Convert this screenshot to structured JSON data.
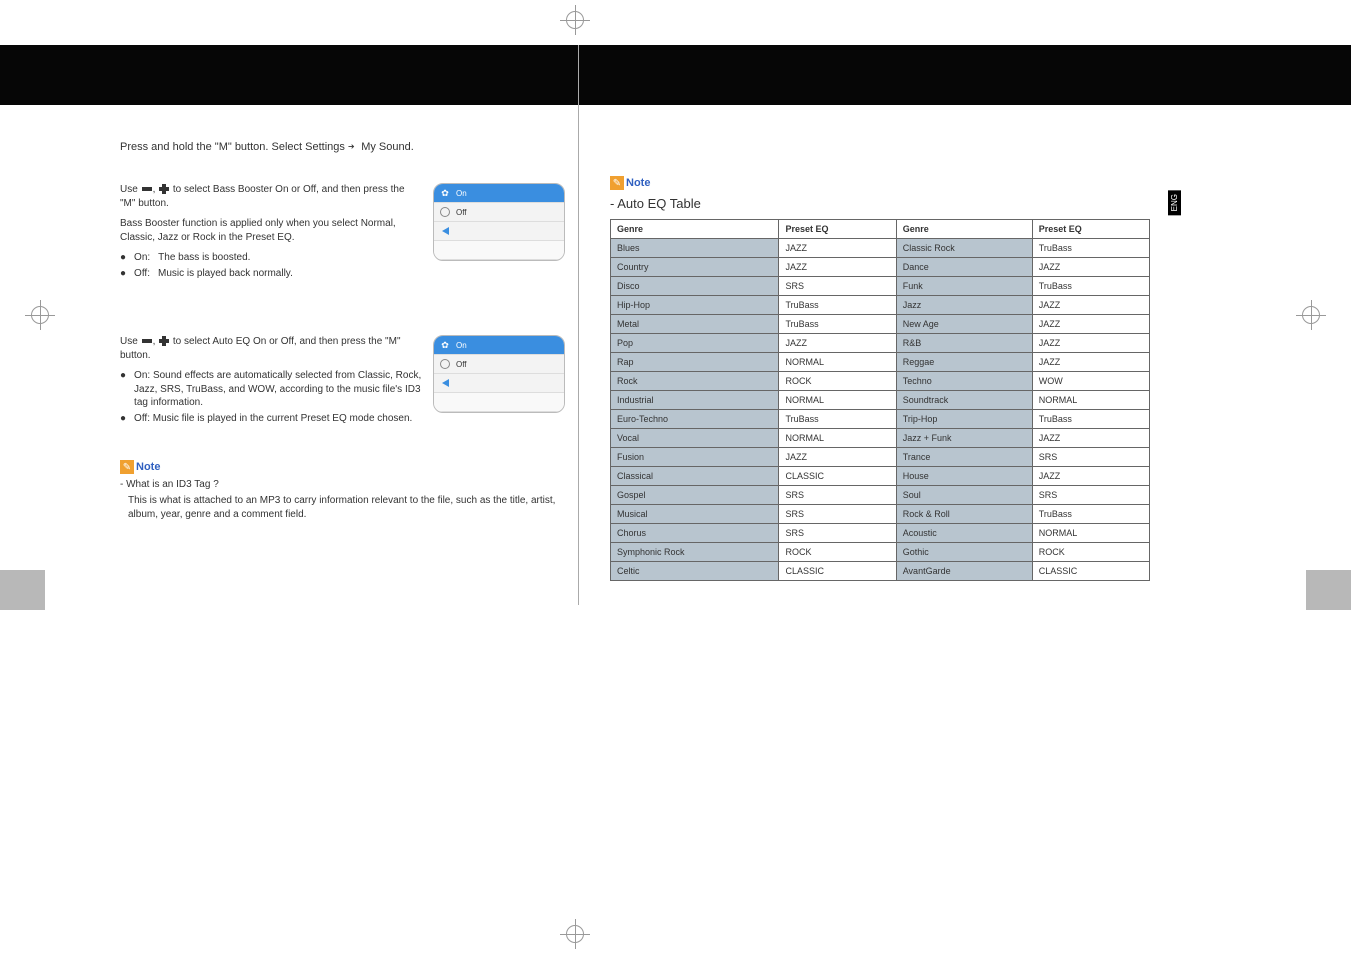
{
  "eng_label": "ENG",
  "intro_part1": "Press and hold the \"M\" button. Select Settings",
  "intro_part2": "My Sound.",
  "section1": {
    "line1_pre": "Use ",
    "line1_mid": ", ",
    "line1_post": " to select Bass Booster On or Off, and then press the \"M\" button.",
    "line2": "Bass Booster function is applied only when you select Normal, Classic, Jazz or Rock in the Preset EQ.",
    "bullet_on_label": "On:",
    "bullet_on_text": "The bass is boosted.",
    "bullet_off_label": "Off:",
    "bullet_off_text": "Music is played back normally."
  },
  "device1": {
    "row1": "On",
    "row2": "Off"
  },
  "section2": {
    "line1_pre": "Use ",
    "line1_mid": ", ",
    "line1_post": " to select Auto EQ On or Off, and then press the \"M\" button.",
    "bullet_on_label": "On:",
    "bullet_on_text": "Sound effects are automatically selected from Classic, Rock, Jazz, SRS, TruBass, and WOW, according to the music file's ID3 tag information.",
    "bullet_off_label": "Off:",
    "bullet_off_text": "Music file is played in the current Preset EQ mode chosen."
  },
  "device2": {
    "row1": "On",
    "row2": "Off"
  },
  "note_label": "Note",
  "note_left": {
    "title": "- What is an ID3 Tag ?",
    "body": "This is what is attached to an MP3 to carry information relevant to the file, such as the title, artist, album, year, genre and a comment field."
  },
  "auto_eq_title": "- Auto EQ Table",
  "table_headers": {
    "h1": "Genre",
    "h2": "Preset EQ",
    "h3": "Genre",
    "h4": "Preset EQ"
  },
  "table_rows": [
    {
      "g1": "Blues",
      "e1": "JAZZ",
      "g2": "Classic Rock",
      "e2": "TruBass"
    },
    {
      "g1": "Country",
      "e1": "JAZZ",
      "g2": "Dance",
      "e2": "JAZZ"
    },
    {
      "g1": "Disco",
      "e1": "SRS",
      "g2": "Funk",
      "e2": "TruBass"
    },
    {
      "g1": "Hip-Hop",
      "e1": "TruBass",
      "g2": "Jazz",
      "e2": "JAZZ"
    },
    {
      "g1": "Metal",
      "e1": "TruBass",
      "g2": "New Age",
      "e2": "JAZZ"
    },
    {
      "g1": "Pop",
      "e1": "JAZZ",
      "g2": "R&B",
      "e2": "JAZZ"
    },
    {
      "g1": "Rap",
      "e1": "NORMAL",
      "g2": "Reggae",
      "e2": "JAZZ"
    },
    {
      "g1": "Rock",
      "e1": "ROCK",
      "g2": "Techno",
      "e2": "WOW"
    },
    {
      "g1": "Industrial",
      "e1": "NORMAL",
      "g2": "Soundtrack",
      "e2": "NORMAL"
    },
    {
      "g1": "Euro-Techno",
      "e1": "TruBass",
      "g2": "Trip-Hop",
      "e2": "TruBass"
    },
    {
      "g1": "Vocal",
      "e1": "NORMAL",
      "g2": "Jazz + Funk",
      "e2": "JAZZ"
    },
    {
      "g1": "Fusion",
      "e1": "JAZZ",
      "g2": "Trance",
      "e2": "SRS"
    },
    {
      "g1": "Classical",
      "e1": "CLASSIC",
      "g2": "House",
      "e2": "JAZZ"
    },
    {
      "g1": "Gospel",
      "e1": "SRS",
      "g2": "Soul",
      "e2": "SRS"
    },
    {
      "g1": "Musical",
      "e1": "SRS",
      "g2": "Rock & Roll",
      "e2": "TruBass"
    },
    {
      "g1": "Chorus",
      "e1": "SRS",
      "g2": "Acoustic",
      "e2": "NORMAL"
    },
    {
      "g1": "Symphonic Rock",
      "e1": "ROCK",
      "g2": "Gothic",
      "e2": "ROCK"
    },
    {
      "g1": "Celtic",
      "e1": "CLASSIC",
      "g2": "AvantGarde",
      "e2": "CLASSIC"
    }
  ]
}
